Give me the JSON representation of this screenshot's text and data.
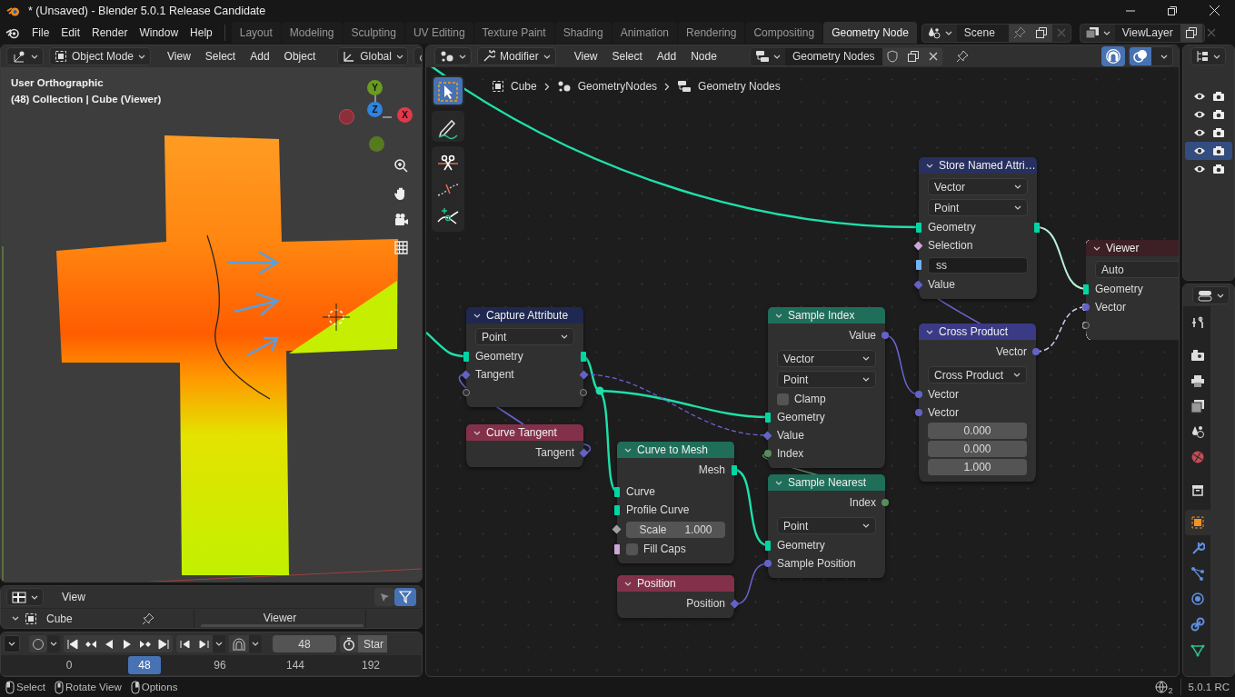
{
  "window": {
    "title": "* (Unsaved) - Blender 5.0.1 Release Candidate"
  },
  "menu": [
    "File",
    "Edit",
    "Render",
    "Window",
    "Help"
  ],
  "workspaces": [
    {
      "label": "Layout",
      "selected": false
    },
    {
      "label": "Modeling",
      "selected": false
    },
    {
      "label": "Sculpting",
      "selected": false
    },
    {
      "label": "UV Editing",
      "selected": false
    },
    {
      "label": "Texture Paint",
      "selected": false
    },
    {
      "label": "Shading",
      "selected": false
    },
    {
      "label": "Animation",
      "selected": false
    },
    {
      "label": "Rendering",
      "selected": false
    },
    {
      "label": "Compositing",
      "selected": false
    },
    {
      "label": "Geometry Node",
      "selected": true
    }
  ],
  "scene": "Scene",
  "view_layer": "ViewLayer",
  "viewport": {
    "mode": "Object Mode",
    "menus": [
      "View",
      "Select",
      "Add",
      "Object"
    ],
    "orientation": "Global",
    "info": [
      "User Orthographic",
      "(48) Collection | Cube (Viewer)"
    ],
    "axes": [
      "Y",
      "Z",
      "X"
    ]
  },
  "spreadsheet": {
    "menus": [
      "View"
    ],
    "object": "Cube",
    "column": "Viewer"
  },
  "timeline": {
    "frame": "48",
    "start_label": "Star",
    "ruler": [
      {
        "label": "0",
        "selected": false
      },
      {
        "label": "48",
        "selected": true
      },
      {
        "label": "96",
        "selected": false
      },
      {
        "label": "144",
        "selected": false
      },
      {
        "label": "192",
        "selected": false
      }
    ]
  },
  "node_editor": {
    "context": "Modifier",
    "menus": [
      "View",
      "Select",
      "Add",
      "Node"
    ],
    "node_group": "Geometry Nodes",
    "breadcrumbs": [
      "Cube",
      "GeometryNodes",
      "Geometry Nodes"
    ],
    "tools": [
      {
        "selected": true
      },
      {
        "selected": false
      },
      {
        "selected": false
      },
      {
        "selected": false
      },
      {
        "selected": false
      }
    ],
    "nodes": [
      {
        "title": "Store Named Attri…",
        "color": "#27305e",
        "selected": false,
        "rows": [
          {
            "kind": "dropdown",
            "value": "Vector"
          },
          {
            "kind": "dropdown",
            "value": "Point"
          },
          {
            "kind": "through",
            "label": "Geometry",
            "socket": {
              "kind": "geometry"
            }
          },
          {
            "kind": "input",
            "label": "Selection",
            "socket": {
              "kind": "bool_field"
            }
          },
          {
            "kind": "field",
            "value": "ss",
            "socket": {
              "kind": "string"
            }
          },
          {
            "kind": "input",
            "label": "Value",
            "socket": {
              "kind": "vector_field"
            }
          }
        ]
      },
      {
        "title": "Viewer",
        "color": "#3d1f26",
        "selected": true,
        "rows": [
          {
            "kind": "dropdown",
            "value": "Auto"
          },
          {
            "kind": "input",
            "label": "Geometry",
            "socket": {
              "kind": "geometry"
            }
          },
          {
            "kind": "input",
            "label": "Vector",
            "socket": {
              "kind": "vector"
            }
          },
          {
            "kind": "input",
            "socket": {
              "kind": "empty"
            }
          }
        ]
      },
      {
        "title": "Capture Attribute",
        "color": "#1e2850",
        "selected": false,
        "rows": [
          {
            "kind": "dropdown",
            "value": "Point"
          },
          {
            "kind": "through",
            "label": "Geometry",
            "socket": {
              "kind": "geometry"
            }
          },
          {
            "kind": "through",
            "label": "Tangent",
            "socket": {
              "kind": "vector_field"
            }
          },
          {
            "kind": "through",
            "socket": {
              "kind": "empty"
            }
          }
        ]
      },
      {
        "title": "Sample Index",
        "color": "#1e6e5a",
        "selected": false,
        "rows": [
          {
            "kind": "output",
            "label": "Value",
            "socket": {
              "kind": "vector"
            }
          },
          {
            "kind": "dropdown",
            "value": "Vector"
          },
          {
            "kind": "dropdown",
            "value": "Point"
          },
          {
            "kind": "checkbox",
            "label": "Clamp",
            "checked": false
          },
          {
            "kind": "input",
            "label": "Geometry",
            "socket": {
              "kind": "geometry"
            }
          },
          {
            "kind": "input",
            "label": "Value",
            "socket": {
              "kind": "vector_field"
            }
          },
          {
            "kind": "input",
            "label": "Index",
            "socket": {
              "kind": "int"
            }
          }
        ]
      },
      {
        "title": "Cross Product",
        "color": "#3b3a86",
        "selected": false,
        "rows": [
          {
            "kind": "output",
            "label": "Vector",
            "socket": {
              "kind": "vector"
            }
          },
          {
            "kind": "dropdown",
            "value": "Cross Product"
          },
          {
            "kind": "input",
            "label": "Vector",
            "socket": {
              "kind": "vector"
            }
          },
          {
            "kind": "input",
            "label": "Vector",
            "socket": {
              "kind": "vector"
            }
          },
          {
            "kind": "value",
            "value": "0.000"
          },
          {
            "kind": "value",
            "value": "0.000"
          },
          {
            "kind": "value",
            "value": "1.000"
          }
        ]
      },
      {
        "title": "Curve Tangent",
        "color": "#83314a",
        "selected": false,
        "rows": [
          {
            "kind": "output",
            "label": "Tangent",
            "socket": {
              "kind": "vector_field"
            }
          }
        ]
      },
      {
        "title": "Curve to Mesh",
        "color": "#1e6e5a",
        "selected": false,
        "rows": [
          {
            "kind": "output",
            "label": "Mesh",
            "socket": {
              "kind": "geometry"
            }
          },
          {
            "kind": "input",
            "label": "Curve",
            "socket": {
              "kind": "geometry"
            }
          },
          {
            "kind": "input",
            "label": "Profile Curve",
            "socket": {
              "kind": "geometry"
            }
          },
          {
            "kind": "number",
            "label": "Scale",
            "value": "1.000",
            "socket": {
              "kind": "float_field"
            }
          },
          {
            "kind": "checkbox",
            "label": "Fill Caps",
            "checked": false,
            "socket": {
              "kind": "bool"
            }
          }
        ]
      },
      {
        "title": "Sample Nearest",
        "color": "#1e6e5a",
        "selected": false,
        "rows": [
          {
            "kind": "output",
            "label": "Index",
            "socket": {
              "kind": "int"
            }
          },
          {
            "kind": "dropdown",
            "value": "Point"
          },
          {
            "kind": "input",
            "label": "Geometry",
            "socket": {
              "kind": "geometry"
            }
          },
          {
            "kind": "input",
            "label": "Sample Position",
            "socket": {
              "kind": "vector"
            }
          }
        ]
      },
      {
        "title": "Position",
        "color": "#83314a",
        "selected": false,
        "rows": [
          {
            "kind": "output",
            "label": "Position",
            "socket": {
              "kind": "vector_field"
            }
          }
        ]
      }
    ]
  },
  "outliner": {
    "rows": [
      {
        "selected": false
      },
      {
        "selected": false
      },
      {
        "selected": false
      },
      {
        "selected": true
      },
      {
        "selected": false
      }
    ]
  },
  "properties": {
    "tabs": [
      {
        "selected": false
      },
      {
        "selected": false
      },
      {
        "selected": false
      },
      {
        "selected": false
      },
      {
        "selected": false
      },
      {
        "selected": false
      },
      {
        "selected": false
      },
      {
        "selected": true
      },
      {
        "selected": false
      },
      {
        "selected": false
      },
      {
        "selected": false
      },
      {
        "selected": false
      },
      {
        "selected": false
      }
    ]
  },
  "status_bar": {
    "hints": [
      "Select",
      "Rotate View",
      "Options"
    ],
    "indicator": "2",
    "version": "5.0.1 RC"
  }
}
